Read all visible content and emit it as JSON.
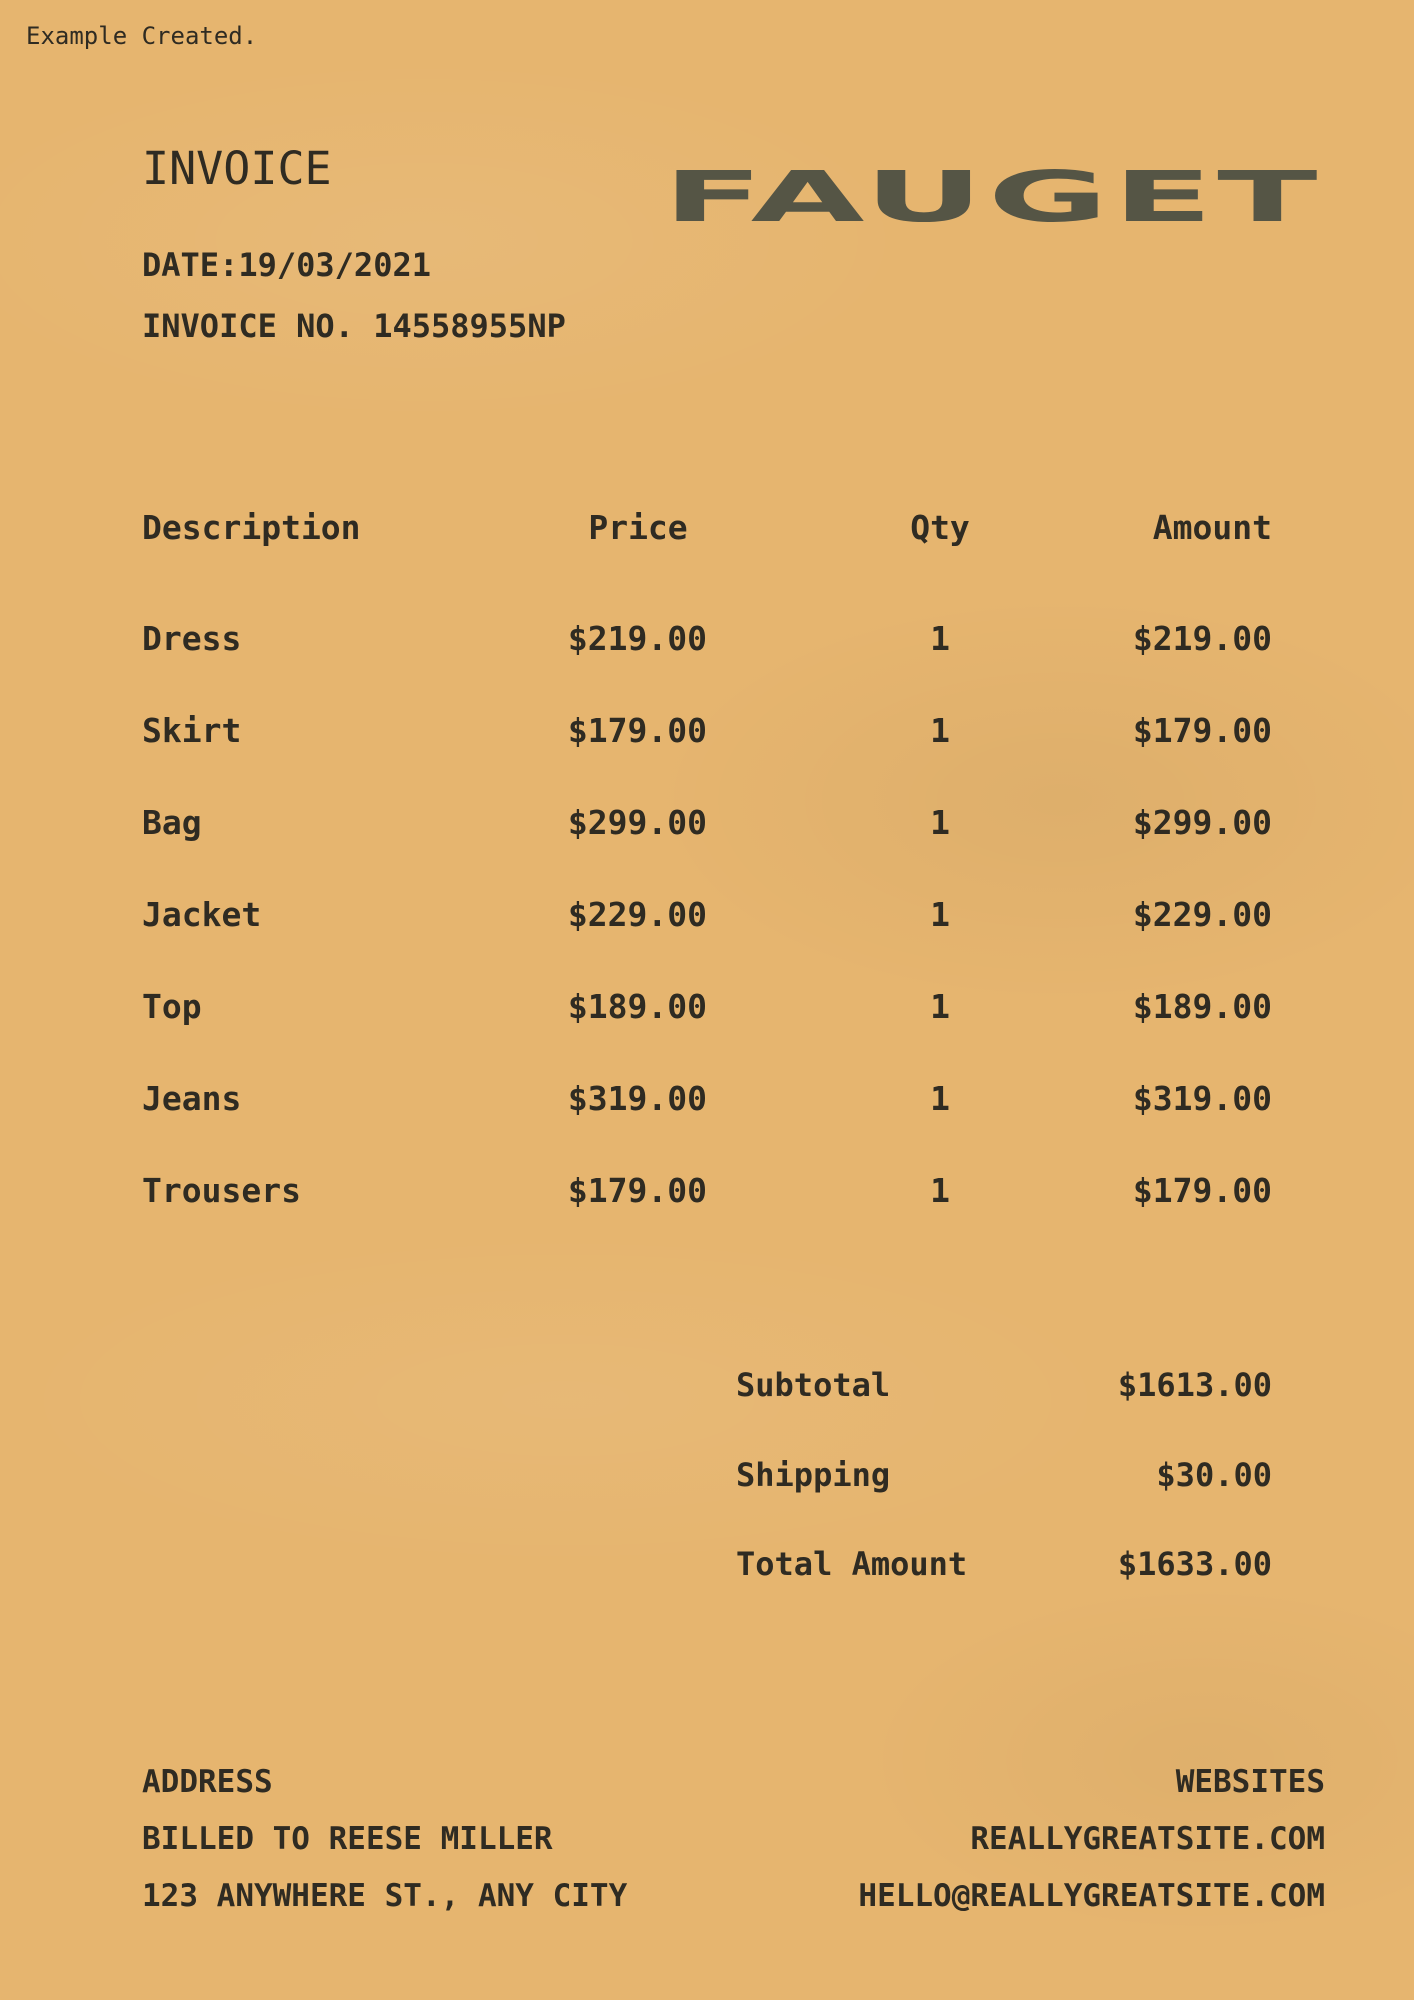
{
  "caption": "Example Created.",
  "header": {
    "title": "INVOICE",
    "date": "DATE:19/03/2021",
    "invoice_no": "INVOICE NO. 14558955NP",
    "brand": "FAUGET"
  },
  "table": {
    "columns": [
      "Description",
      "Price",
      "Qty",
      "Amount"
    ],
    "rows": [
      {
        "description": "Dress",
        "price": "$219.00",
        "qty": "1",
        "amount": "$219.00"
      },
      {
        "description": "Skirt",
        "price": "$179.00",
        "qty": "1",
        "amount": "$179.00"
      },
      {
        "description": "Bag",
        "price": "$299.00",
        "qty": "1",
        "amount": "$299.00"
      },
      {
        "description": "Jacket",
        "price": "$229.00",
        "qty": "1",
        "amount": "$229.00"
      },
      {
        "description": "Top",
        "price": "$189.00",
        "qty": "1",
        "amount": "$189.00"
      },
      {
        "description": "Jeans",
        "price": "$319.00",
        "qty": "1",
        "amount": "$319.00"
      },
      {
        "description": "Trousers",
        "price": "$179.00",
        "qty": "1",
        "amount": "$179.00"
      }
    ]
  },
  "summary": {
    "subtotal_label": "Subtotal",
    "subtotal_value": "$1613.00",
    "shipping_label": "Shipping",
    "shipping_value": "$30.00",
    "total_label": "Total Amount",
    "total_value": "$1633.00"
  },
  "footer": {
    "address_heading": "ADDRESS",
    "billed_to": "BILLED TO REESE MILLER",
    "street": "123 ANYWHERE ST., ANY CITY",
    "websites_heading": "WEBSITES",
    "website": "REALLYGREATSITE.COM",
    "email": "HELLO@REALLYGREATSITE.COM"
  },
  "colors": {
    "paper": "#e6b56f",
    "text": "#2f2b22",
    "logo": "#555545"
  }
}
